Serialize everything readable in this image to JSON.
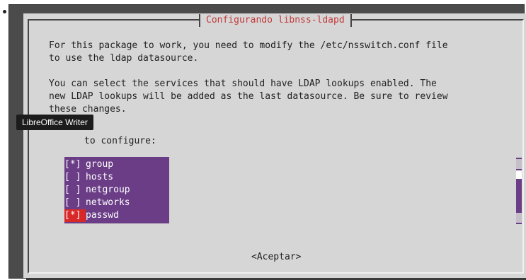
{
  "window": {
    "title": "Configurando libnss-ldapd"
  },
  "description": {
    "line1": "For this package to work, you need to modify the /etc/nsswitch.conf file",
    "line2": "to use the ldap datasource.",
    "line3": "",
    "line4": "You can select the services that should have LDAP lookups enabled. The",
    "line5": "new LDAP lookups will be added as the last datasource. Be sure to review",
    "line6": "these changes."
  },
  "services_label": "to configure:",
  "tooltip": "LibreOffice Writer",
  "list": {
    "items": [
      {
        "checkbox": "[*]",
        "name": "group",
        "checked": true
      },
      {
        "checkbox": "[ ]",
        "name": "hosts",
        "checked": false
      },
      {
        "checkbox": "[ ]",
        "name": "netgroup",
        "checked": false
      },
      {
        "checkbox": "[ ]",
        "name": "networks",
        "checked": false
      },
      {
        "checkbox": "[*]",
        "name": "passwd",
        "checked": true
      }
    ]
  },
  "buttons": {
    "accept": "<Aceptar>"
  },
  "colors": {
    "list_bg": "#6a3d86",
    "title_fg": "#c23a3a",
    "dialog_bg": "#d6d6d6",
    "highlight": "#d82828"
  }
}
